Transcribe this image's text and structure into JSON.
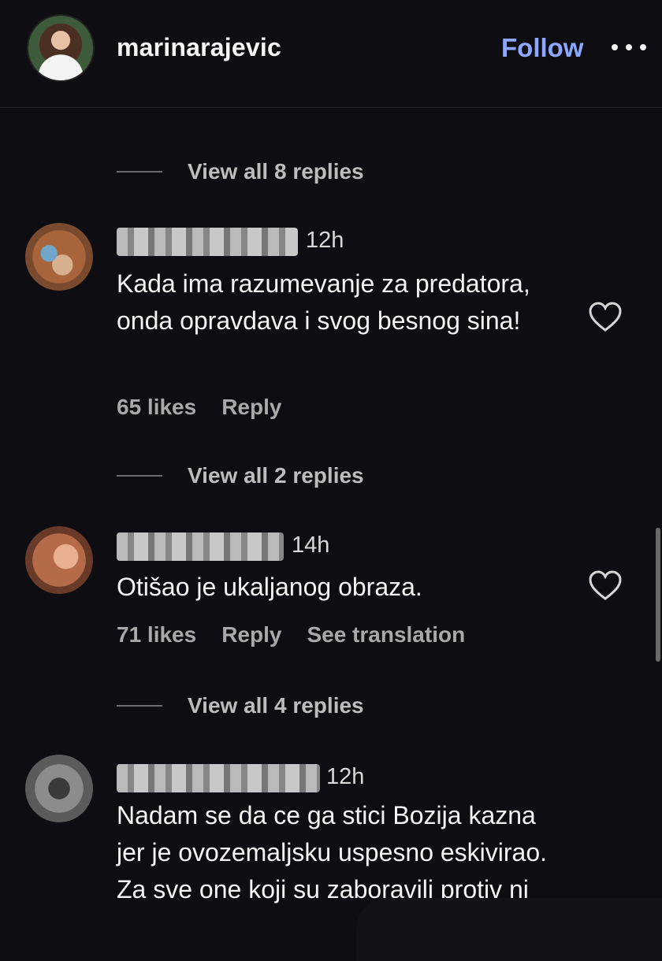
{
  "header": {
    "username": "marinarajevic",
    "follow_label": "Follow"
  },
  "threads": [
    {
      "view_replies": "View all 8 replies"
    },
    {
      "view_replies": "View all 2 replies"
    },
    {
      "view_replies": "View all 4 replies"
    }
  ],
  "comments": [
    {
      "time": "12h",
      "text": "Kada ima razumevanje za predatora, onda opravdava i svog besnog sina!",
      "likes": "65 likes",
      "reply": "Reply"
    },
    {
      "time": "14h",
      "text": "Otišao je ukaljanog obraza.",
      "likes": "71 likes",
      "reply": "Reply",
      "translate": "See translation"
    },
    {
      "time": "12h",
      "text": "Nadam se da ce ga stici Bozija kazna jer je ovozemaljsku uspesno eskivirao. Za sve one koji su zaboravili protiv nj"
    }
  ],
  "icons": [
    "more-options-icon",
    "heart-icon"
  ],
  "colors": {
    "background": "#0d0d12",
    "follow": "#8fa8ff",
    "text": "#f4f4f4",
    "muted": "#a9a9a9"
  }
}
